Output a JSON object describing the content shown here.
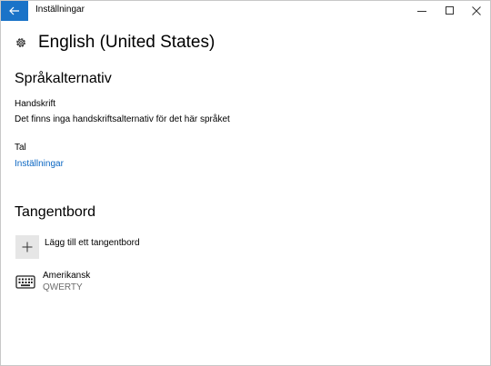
{
  "window": {
    "title": "Inställningar"
  },
  "page": {
    "title": "English (United States)"
  },
  "language_options": {
    "heading": "Språkalternativ",
    "handwriting_label": "Handskrift",
    "handwriting_desc": "Det finns inga handskriftsalternativ för det här språket",
    "speech_label": "Tal",
    "speech_link": "Inställningar"
  },
  "keyboard": {
    "heading": "Tangentbord",
    "add_label": "Lägg till ett tangentbord",
    "items": [
      {
        "name": "Amerikansk",
        "layout": "QWERTY",
        "icon": "keyboard-icon"
      }
    ]
  },
  "colors": {
    "accent": "#1a73c8",
    "link": "#0a66c2"
  }
}
